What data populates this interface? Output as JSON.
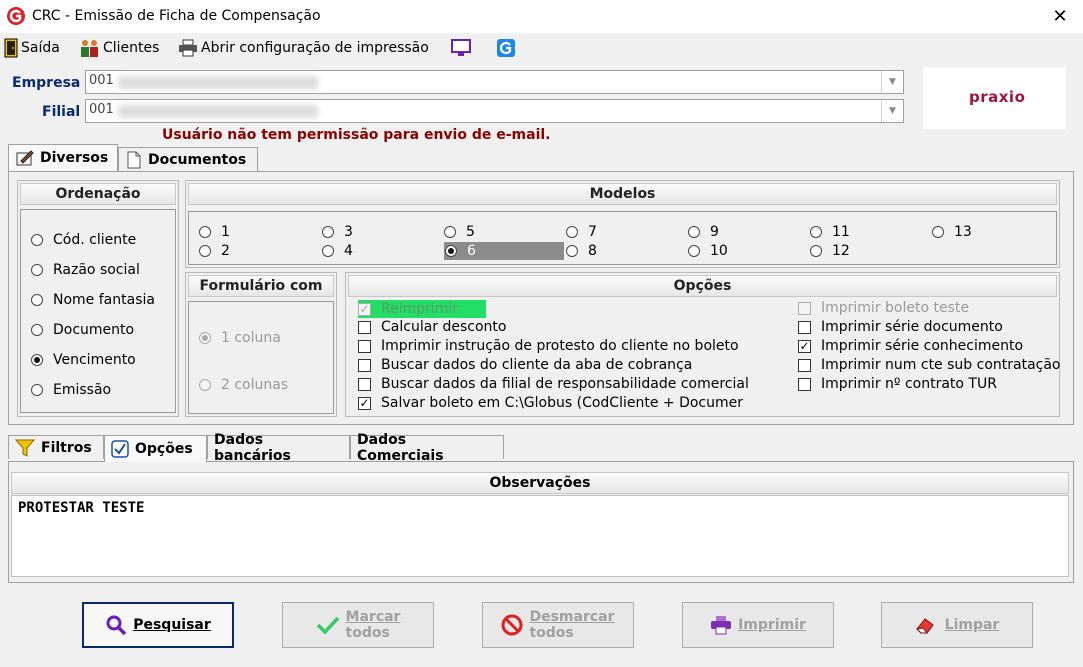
{
  "window": {
    "title": "CRC - Emissão de Ficha de Compensação"
  },
  "menu": {
    "saida": "Saída",
    "clientes": "Clientes",
    "abrir_config": "Abrir configuração de impressão"
  },
  "empresa": {
    "label": "Empresa",
    "code": "001"
  },
  "filial": {
    "label": "Filial",
    "code": "001"
  },
  "warning": "Usuário não tem permissão para envio de e-mail.",
  "brand": "praxio",
  "tabs": [
    {
      "label": "Diversos"
    },
    {
      "label": "Documentos"
    }
  ],
  "ordenacao": {
    "title": "Ordenação",
    "options": [
      "Cód. cliente",
      "Razão social",
      "Nome fantasia",
      "Documento",
      "Vencimento",
      "Emissão"
    ],
    "selected": "Vencimento"
  },
  "modelos": {
    "title": "Modelos",
    "options": [
      "1",
      "2",
      "3",
      "4",
      "5",
      "6",
      "7",
      "8",
      "9",
      "10",
      "11",
      "12",
      "13"
    ],
    "selected": "6"
  },
  "formulario": {
    "title": "Formulário com",
    "options": [
      "1 coluna",
      "2 colunas"
    ],
    "selected": "1 coluna"
  },
  "opcoes": {
    "title": "Opções",
    "left": [
      {
        "label": "Reimprimir",
        "checked": true,
        "disabled": true
      },
      {
        "label": "Calcular desconto",
        "checked": false
      },
      {
        "label": "Imprimir instrução de protesto do cliente no boleto",
        "checked": false
      },
      {
        "label": "Buscar dados do cliente da aba de cobrança",
        "checked": false
      },
      {
        "label": "Buscar dados da filial de responsabilidade comercial",
        "checked": false
      },
      {
        "label": "Salvar boleto em C:\\Globus (CodCliente + Documer",
        "checked": true
      }
    ],
    "right": [
      {
        "label": "Imprimir boleto teste",
        "checked": false,
        "disabled": true
      },
      {
        "label": "Imprimir série documento",
        "checked": false
      },
      {
        "label": "Imprimir série conhecimento",
        "checked": true
      },
      {
        "label": "Imprimir num cte sub contratação",
        "checked": false
      },
      {
        "label": "Imprimir nº contrato TUR",
        "checked": false
      }
    ]
  },
  "lower_tabs": [
    {
      "label": "Filtros"
    },
    {
      "label": "Opções"
    },
    {
      "label": "Dados bancários"
    },
    {
      "label": "Dados Comerciais"
    }
  ],
  "observacoes": {
    "title": "Observações",
    "text": "PROTESTAR TESTE"
  },
  "buttons": {
    "pesquisar": "Pesquisar",
    "marcar_1": "Marcar",
    "marcar_2": "todos",
    "desmarcar_1": "Desmarcar",
    "desmarcar_2": "todos",
    "imprimir": "Imprimir",
    "limpar": "Limpar"
  },
  "colors": {
    "accent": "#0b2a6e",
    "warning": "#8b0000",
    "brand": "#a0153e",
    "highlight": "#22dd66"
  }
}
